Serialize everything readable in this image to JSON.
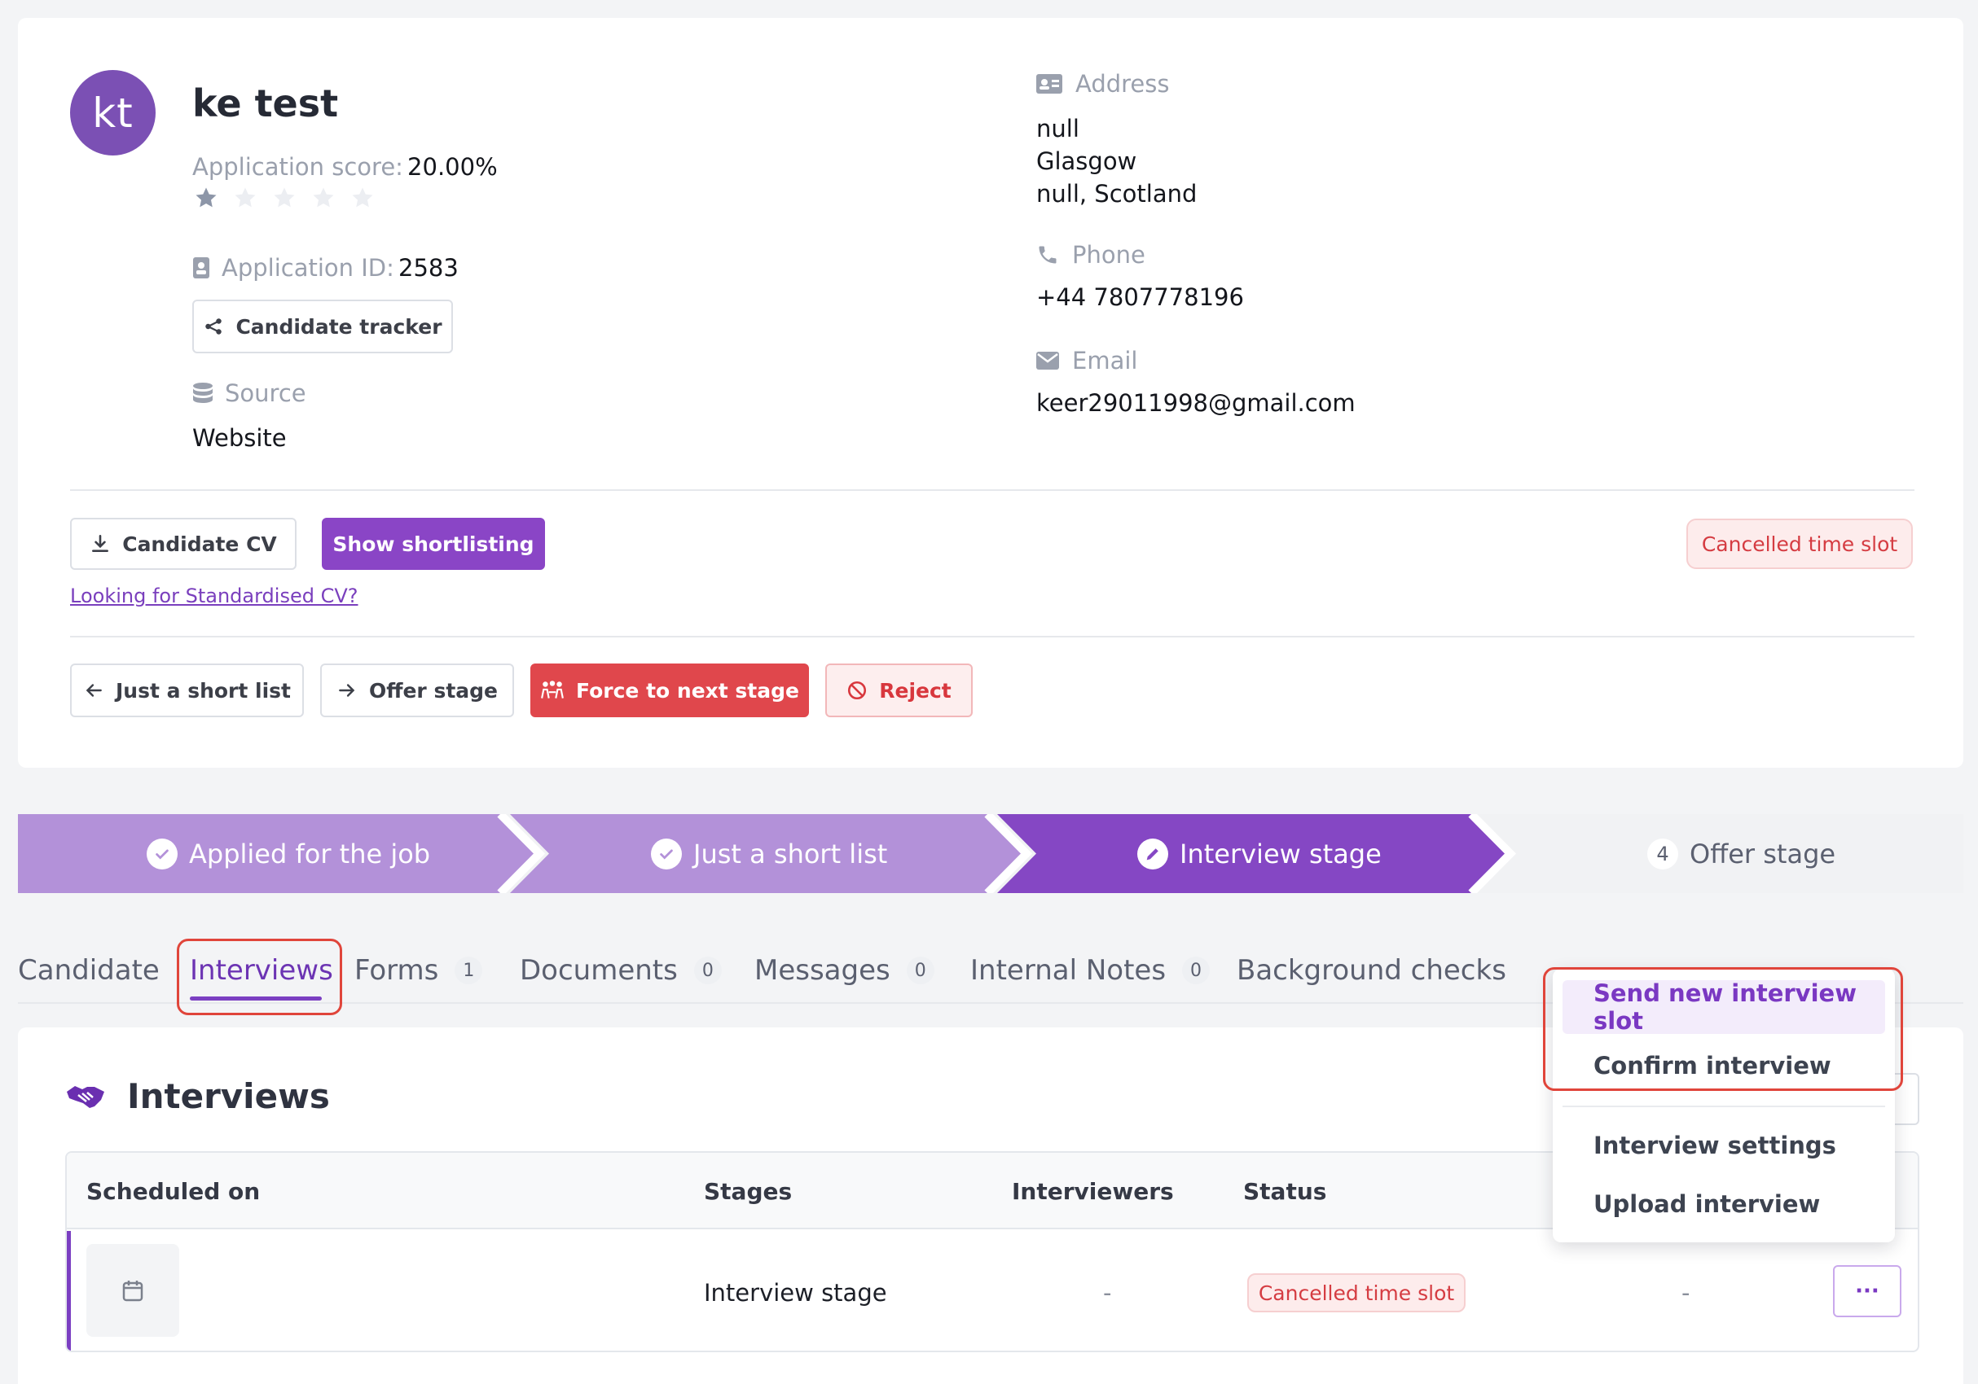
{
  "candidate": {
    "initials": "kt",
    "name": "ke test",
    "score_label": "Application score:",
    "score_value": "20.00%",
    "rating": 1,
    "rating_max": 5,
    "app_id_label": "Application ID:",
    "app_id_value": "2583",
    "tracker_button": "Candidate tracker",
    "source_label": "Source",
    "source_value": "Website"
  },
  "contact": {
    "address_label": "Address",
    "address_lines": [
      "null",
      "Glasgow",
      "null, Scotland"
    ],
    "phone_label": "Phone",
    "phone_value": "+44 7807778196",
    "email_label": "Email",
    "email_value": "keer29011998@gmail.com"
  },
  "actions": {
    "cv_button": "Candidate CV",
    "shortlisting_button": "Show shortlisting",
    "status_badge": "Cancelled time slot",
    "standardised_link": "Looking for Standardised CV?",
    "prev_stage_button": "Just a short list",
    "next_stage_button": "Offer stage",
    "force_button": "Force to next stage",
    "reject_button": "Reject"
  },
  "stepper": {
    "steps": [
      {
        "label": "Applied for the job",
        "state": "done"
      },
      {
        "label": "Just a short list",
        "state": "done"
      },
      {
        "label": "Interview stage",
        "state": "current"
      },
      {
        "label": "Offer stage",
        "state": "todo",
        "number": "4"
      }
    ]
  },
  "tabs": [
    {
      "label": "Candidate"
    },
    {
      "label": "Interviews",
      "active": true
    },
    {
      "label": "Forms",
      "count": "1"
    },
    {
      "label": "Documents",
      "count": "0"
    },
    {
      "label": "Messages",
      "count": "0"
    },
    {
      "label": "Internal Notes",
      "count": "0"
    },
    {
      "label": "Background checks"
    }
  ],
  "interviews": {
    "title": "Interviews",
    "columns": [
      "Scheduled on",
      "Stages",
      "Interviewers",
      "Status"
    ],
    "rows": [
      {
        "stage": "Interview stage",
        "interviewers": "-",
        "status": "Cancelled time slot",
        "extra": "-",
        "more": "···"
      }
    ]
  },
  "menu": {
    "items": [
      "Send new interview slot",
      "Confirm interview",
      "Interview settings",
      "Upload interview"
    ]
  },
  "colors": {
    "brand_purple": "#8a45c6",
    "stepper_done": "#b391d9",
    "stepper_current": "#8547c4",
    "danger": "#e0474c"
  }
}
